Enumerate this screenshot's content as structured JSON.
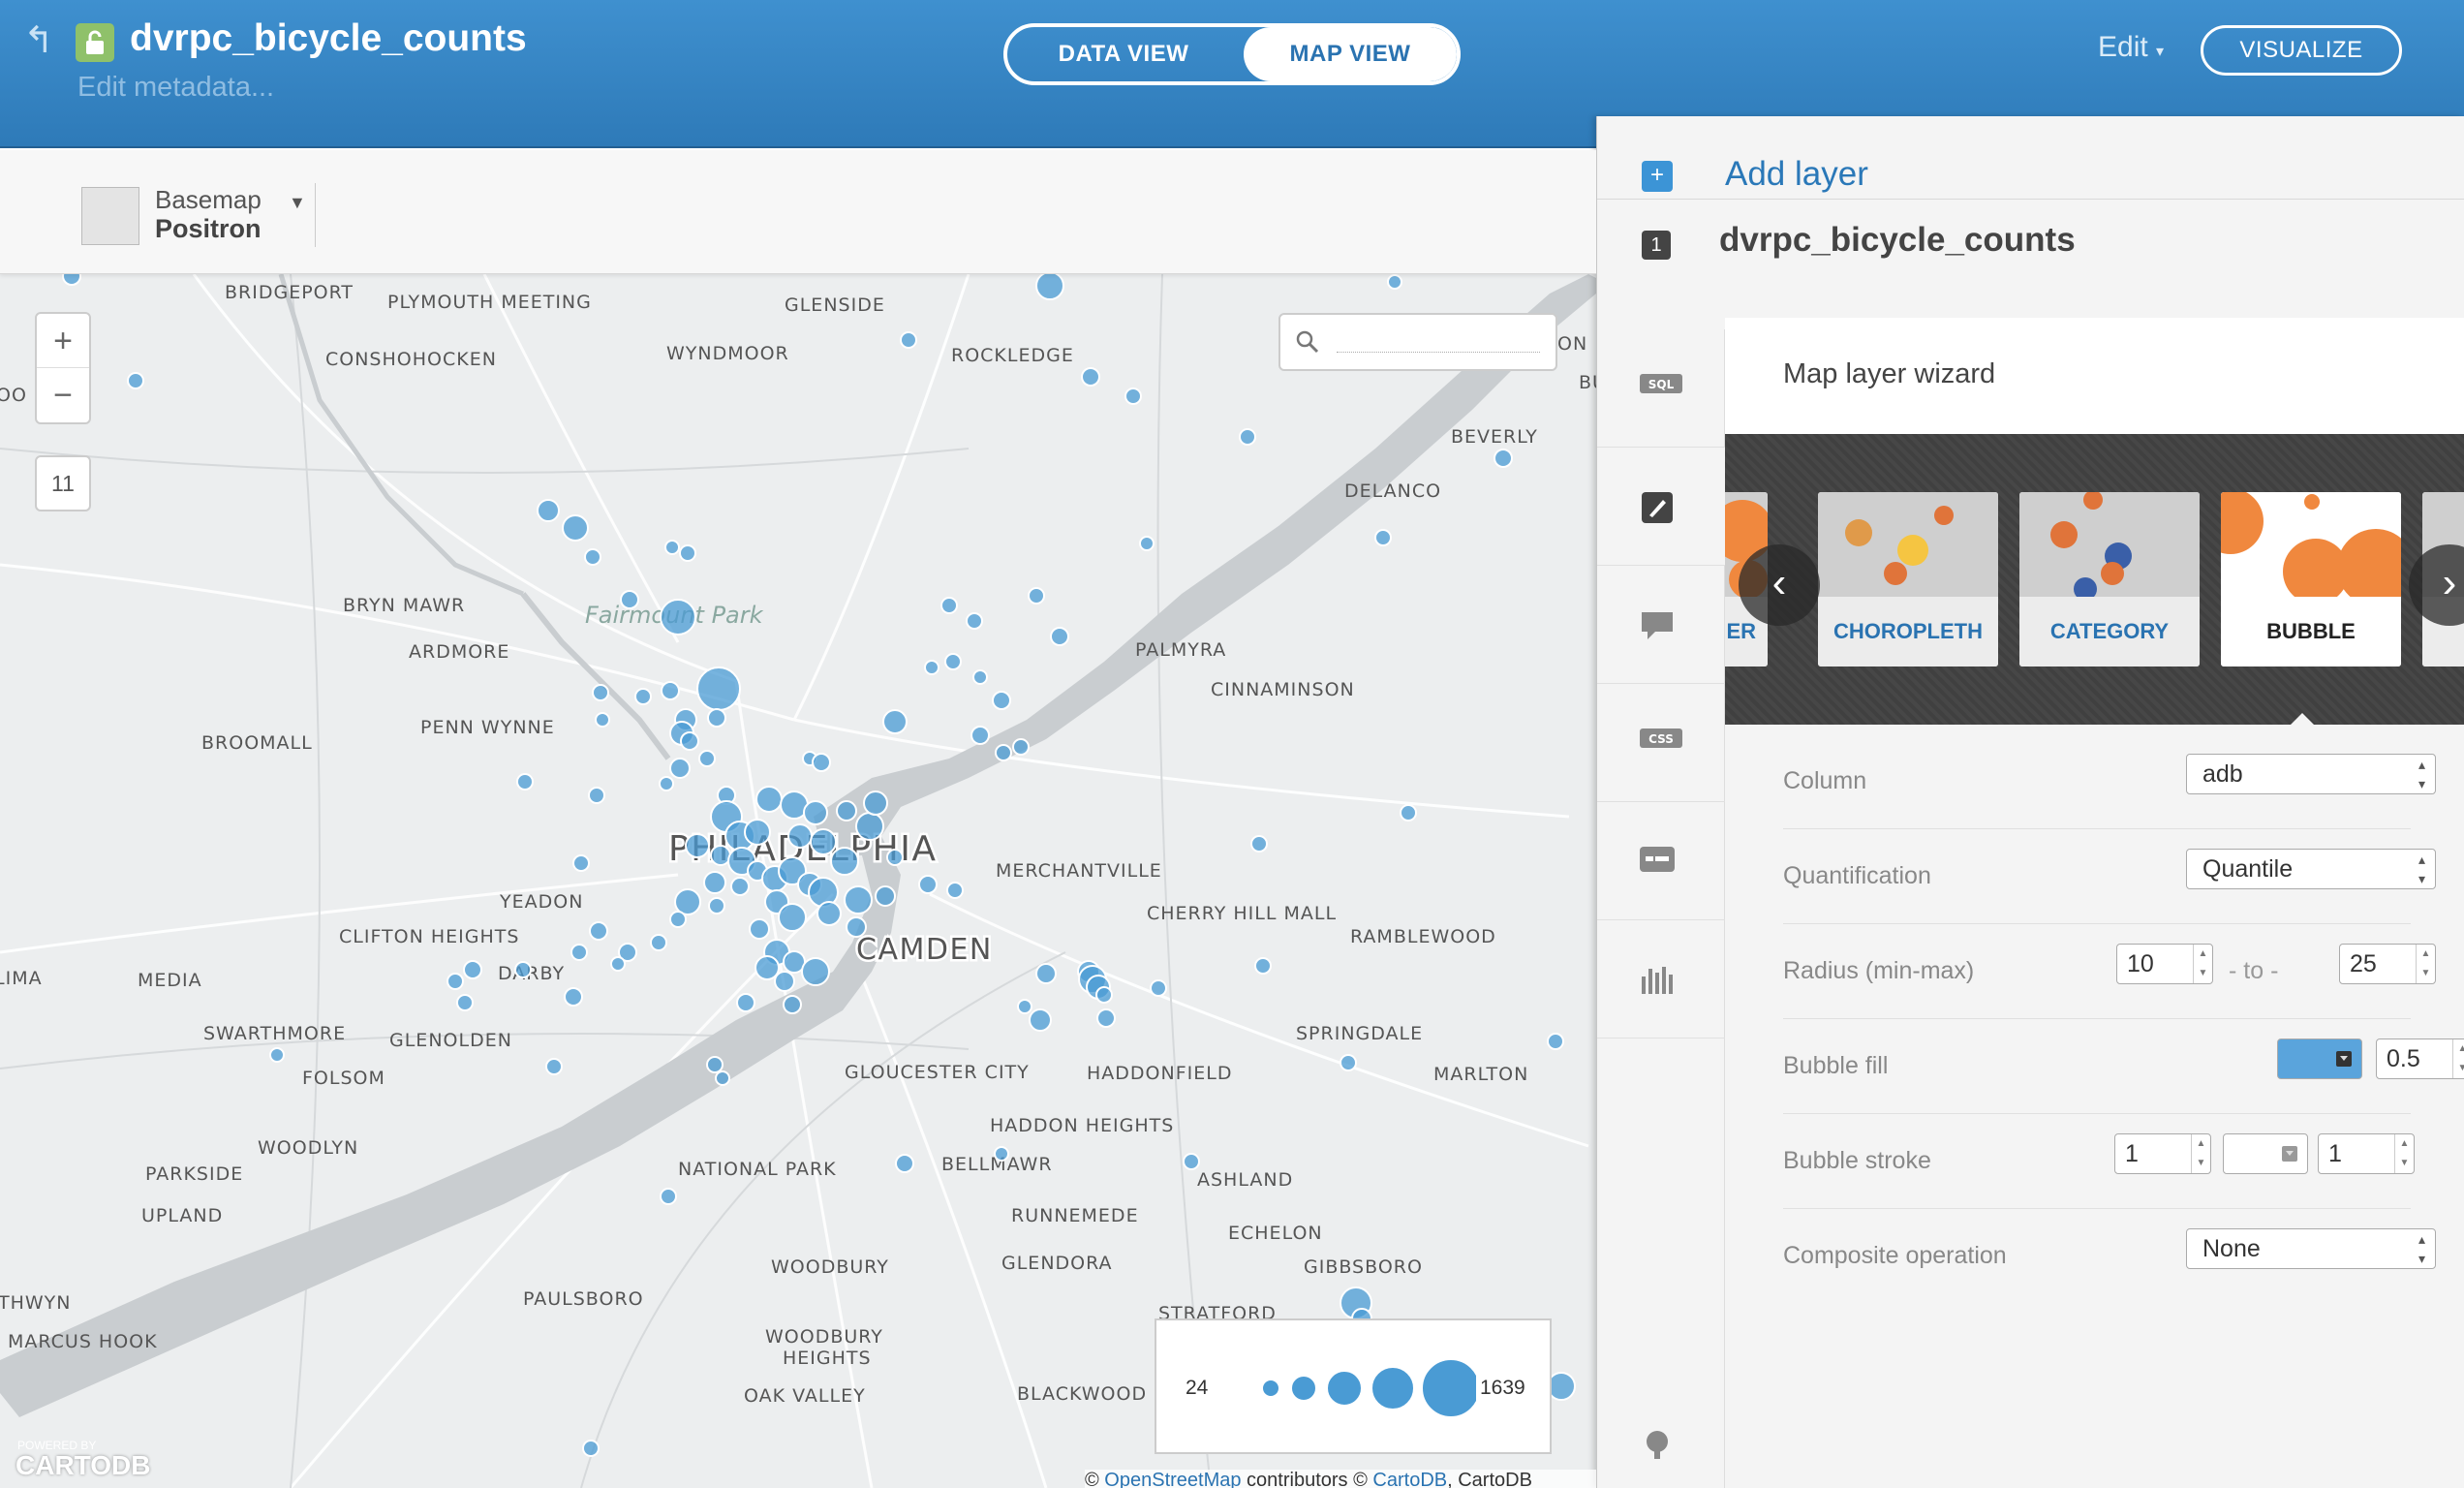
{
  "header": {
    "table_title": "dvrpc_bicycle_counts",
    "edit_metadata": "Edit metadata...",
    "tabs": [
      {
        "label": "DATA VIEW"
      },
      {
        "label": "MAP VIEW"
      }
    ],
    "edit_menu": "Edit",
    "visualize_label": "VISUALIZE"
  },
  "map": {
    "basemap_label": "Basemap",
    "basemap_value": "Positron",
    "zoom_in": "+",
    "zoom_out": "−",
    "zoom_level": "11",
    "places": {
      "bridgeport": "BRIDGEPORT",
      "plymouth_meeting": "PLYMOUTH MEETING",
      "glenside": "GLENSIDE",
      "conshohocken": "CONSHOHOCKEN",
      "wyndmoor": "WYNDMOOR",
      "rockledge": "ROCKLEDGE",
      "beverly": "BEVERLY",
      "delanco": "DELANCO",
      "bryn_mawr": "BRYN MAWR",
      "fairmount_park": "Fairmount Park",
      "ardmore": "ARDMORE",
      "palmyra": "PALMYRA",
      "cinnaminson": "CINNAMINSON",
      "penn_wynne": "PENN WYNNE",
      "broomall": "BROOMALL",
      "philadelphia": "PHILADELPHIA",
      "merchantville": "MERCHANTVILLE",
      "yeadon": "YEADON",
      "cherry_hill_mall": "CHERRY HILL MALL",
      "clifton_heights": "CLIFTON HEIGHTS",
      "camden": "CAMDEN",
      "ramblewood": "RAMBLEWOOD",
      "darby": "DARBY",
      "lima": "LIMA",
      "media": "MEDIA",
      "swarthmore": "SWARTHMORE",
      "glenolden": "GLENOLDEN",
      "springdale": "SPRINGDALE",
      "folsom": "FOLSOM",
      "gloucester_city": "GLOUCESTER CITY",
      "haddonfield": "HADDONFIELD",
      "marlton": "MARLTON",
      "woodlyn": "WOODLYN",
      "haddon_heights": "HADDON HEIGHTS",
      "parkside": "PARKSIDE",
      "national_park": "NATIONAL PARK",
      "bellmawr": "BELLMAWR",
      "ashland": "ASHLAND",
      "upland": "UPLAND",
      "runnemede": "RUNNEMEDE",
      "echelon": "ECHELON",
      "woodbury": "WOODBURY",
      "glendora": "GLENDORA",
      "gibbsboro": "GIBBSBORO",
      "thwyn": "THWYN",
      "paulsboro": "PAULSBORO",
      "stratford": "STRATFORD",
      "marcus_hook": "MARCUS HOOK",
      "woodbury_heights_1": "WOODBURY",
      "woodbury_heights_2": "HEIGHTS",
      "oak_valley": "OAK VALLEY",
      "blackwood": "BLACKWOOD",
      "edge_oo": "OO",
      "edge_on": "ON",
      "edge_bu": "BU"
    },
    "legend": {
      "min": "24",
      "max": "1639"
    },
    "attribution": {
      "prefix": "© ",
      "osm": "OpenStreetMap",
      "middle": " contributors © ",
      "cartodb": "CartoDB",
      "suffix": ", CartoDB"
    },
    "powered_by": "POWERED BY",
    "logo": "CARTODB",
    "bubble_color": "#4a9bd4"
  },
  "panel": {
    "add_layer": "Add layer",
    "layer_number": "1",
    "layer_name": "dvrpc_bicycle_counts",
    "sidebar_icons": [
      "sql-icon",
      "wizard-brush-icon",
      "infowindow-icon",
      "css-icon",
      "legend-icon",
      "chart-icon",
      "filter-icon"
    ],
    "wizard": {
      "title": "Map layer wizard",
      "visualization_types": [
        {
          "label": "ER"
        },
        {
          "label": "CHOROPLETH"
        },
        {
          "label": "CATEGORY"
        },
        {
          "label": "BUBBLE"
        }
      ],
      "fields": {
        "column": {
          "label": "Column",
          "value": "adb"
        },
        "quantification": {
          "label": "Quantification",
          "value": "Quantile"
        },
        "radius": {
          "label": "Radius (min-max)",
          "min": "10",
          "to": "- to -",
          "max": "25"
        },
        "bubble_fill": {
          "label": "Bubble fill",
          "opacity": "0.5",
          "color": "#5aa4dc"
        },
        "bubble_stroke": {
          "label": "Bubble stroke",
          "width": "1",
          "opacity": "1"
        },
        "composite": {
          "label": "Composite operation",
          "value": "None"
        }
      }
    }
  }
}
